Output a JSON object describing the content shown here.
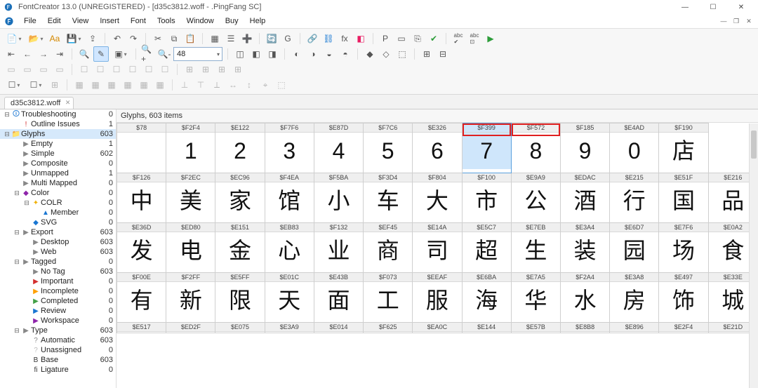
{
  "app": {
    "title": "FontCreator 13.0 (UNREGISTERED) - [d35c3812.woff - .PingFang SC]"
  },
  "menus": [
    "File",
    "Edit",
    "View",
    "Insert",
    "Font",
    "Tools",
    "Window",
    "Buy",
    "Help"
  ],
  "zoom_value": "48",
  "doc_tab": "d35c3812.woff",
  "grid_caption": "Glyphs, 603 items",
  "tree": [
    {
      "d": 0,
      "t": "-",
      "i": "🛈",
      "c": "#1976d2",
      "label": "Troubleshooting",
      "n": "0",
      "hl": false
    },
    {
      "d": 1,
      "t": "",
      "i": "!",
      "c": "#d32f2f",
      "label": "Outline Issues",
      "n": "1",
      "hl": false
    },
    {
      "d": 0,
      "t": "-",
      "i": "📁",
      "c": "#f0b000",
      "label": "Glyphs",
      "n": "603",
      "hl": true
    },
    {
      "d": 1,
      "t": "",
      "i": "▶",
      "c": "#888",
      "label": "Empty",
      "n": "1",
      "hl": false
    },
    {
      "d": 1,
      "t": "",
      "i": "▶",
      "c": "#888",
      "label": "Simple",
      "n": "602",
      "hl": false
    },
    {
      "d": 1,
      "t": "",
      "i": "▶",
      "c": "#888",
      "label": "Composite",
      "n": "0",
      "hl": false
    },
    {
      "d": 1,
      "t": "",
      "i": "▶",
      "c": "#888",
      "label": "Unmapped",
      "n": "1",
      "hl": false
    },
    {
      "d": 1,
      "t": "",
      "i": "▶",
      "c": "#888",
      "label": "Multi Mapped",
      "n": "0",
      "hl": false
    },
    {
      "d": 1,
      "t": "-",
      "i": "◆",
      "c": "#8e24aa",
      "label": "Color",
      "n": "0",
      "hl": false
    },
    {
      "d": 2,
      "t": "-",
      "i": "✦",
      "c": "#f0b000",
      "label": "COLR",
      "n": "0",
      "hl": false
    },
    {
      "d": 3,
      "t": "",
      "i": "▲",
      "c": "#1976d2",
      "label": "Member",
      "n": "0",
      "hl": false
    },
    {
      "d": 2,
      "t": "",
      "i": "◆",
      "c": "#1976d2",
      "label": "SVG",
      "n": "0",
      "hl": false
    },
    {
      "d": 1,
      "t": "-",
      "i": "▶",
      "c": "#888",
      "label": "Export",
      "n": "603",
      "hl": false
    },
    {
      "d": 2,
      "t": "",
      "i": "▶",
      "c": "#888",
      "label": "Desktop",
      "n": "603",
      "hl": false
    },
    {
      "d": 2,
      "t": "",
      "i": "▶",
      "c": "#888",
      "label": "Web",
      "n": "603",
      "hl": false
    },
    {
      "d": 1,
      "t": "-",
      "i": "▶",
      "c": "#888",
      "label": "Tagged",
      "n": "0",
      "hl": false
    },
    {
      "d": 2,
      "t": "",
      "i": "▶",
      "c": "#888",
      "label": "No Tag",
      "n": "603",
      "hl": false
    },
    {
      "d": 2,
      "t": "",
      "i": "▶",
      "c": "#d32f2f",
      "label": "Important",
      "n": "0",
      "hl": false
    },
    {
      "d": 2,
      "t": "",
      "i": "▶",
      "c": "#ffa000",
      "label": "Incomplete",
      "n": "0",
      "hl": false
    },
    {
      "d": 2,
      "t": "",
      "i": "▶",
      "c": "#43a047",
      "label": "Completed",
      "n": "0",
      "hl": false
    },
    {
      "d": 2,
      "t": "",
      "i": "▶",
      "c": "#1976d2",
      "label": "Review",
      "n": "0",
      "hl": false
    },
    {
      "d": 2,
      "t": "",
      "i": "▶",
      "c": "#8e24aa",
      "label": "Workspace",
      "n": "0",
      "hl": false
    },
    {
      "d": 1,
      "t": "-",
      "i": "▶",
      "c": "#888",
      "label": "Type",
      "n": "603",
      "hl": false
    },
    {
      "d": 2,
      "t": "",
      "i": "?",
      "c": "#888",
      "label": "Automatic",
      "n": "603",
      "hl": false
    },
    {
      "d": 2,
      "t": "",
      "i": "?",
      "c": "#bbb",
      "label": "Unassigned",
      "n": "0",
      "hl": false
    },
    {
      "d": 2,
      "t": "",
      "i": "B",
      "c": "#333",
      "label": "Base",
      "n": "603",
      "hl": false
    },
    {
      "d": 2,
      "t": "",
      "i": "fi",
      "c": "#333",
      "label": "Ligature",
      "n": "0",
      "hl": false
    }
  ],
  "grid": [
    {
      "codes": [
        "$78",
        "$F2F4",
        "$E122",
        "$F7F6",
        "$E87D",
        "$F7C6",
        "$E326",
        "$F399",
        "$F572",
        "$F185",
        "$E4AD",
        "$F190"
      ],
      "glyphs": [
        "",
        "1",
        "2",
        "3",
        "4",
        "5",
        "6",
        "7",
        "8",
        "9",
        "0",
        "店"
      ],
      "sel": 7,
      "red": [
        7,
        8
      ]
    },
    {
      "codes": [
        "$F126",
        "$F2EC",
        "$EC96",
        "$F4EA",
        "$F5BA",
        "$F3D4",
        "$F804",
        "$F100",
        "$E9A9",
        "$EDAC",
        "$E215",
        "$E51F",
        "$E216"
      ],
      "glyphs": [
        "中",
        "美",
        "家",
        "馆",
        "小",
        "车",
        "大",
        "市",
        "公",
        "酒",
        "行",
        "国",
        "品"
      ]
    },
    {
      "codes": [
        "$E36D",
        "$ED80",
        "$E151",
        "$EB83",
        "$F132",
        "$EF45",
        "$E14A",
        "$E5C7",
        "$E7EB",
        "$E3A4",
        "$E6D7",
        "$E7F6",
        "$E0A2"
      ],
      "glyphs": [
        "发",
        "电",
        "金",
        "心",
        "业",
        "商",
        "司",
        "超",
        "生",
        "装",
        "园",
        "场",
        "食"
      ]
    },
    {
      "codes": [
        "$F00E",
        "$F2FF",
        "$E5FF",
        "$E01C",
        "$E43B",
        "$F073",
        "$EEAF",
        "$E6BA",
        "$E7A5",
        "$F2A4",
        "$E3A8",
        "$E497",
        "$E33E"
      ],
      "glyphs": [
        "有",
        "新",
        "限",
        "天",
        "面",
        "工",
        "服",
        "海",
        "华",
        "水",
        "房",
        "饰",
        "城"
      ]
    },
    {
      "codes": [
        "$E517",
        "$ED2F",
        "$E075",
        "$E3A9",
        "$E014",
        "$F625",
        "$EA0C",
        "$E144",
        "$E57B",
        "$E8B8",
        "$E896",
        "$E2F4",
        "$E21D"
      ],
      "glyphs": []
    }
  ]
}
